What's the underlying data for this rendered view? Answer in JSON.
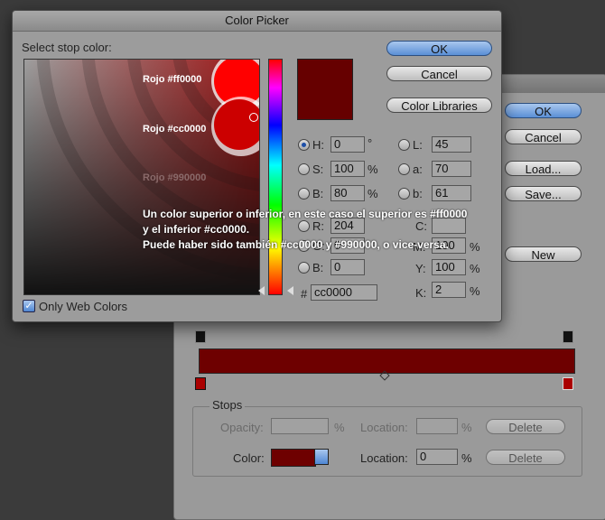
{
  "picker": {
    "title": "Color Picker",
    "select_label": "Select stop color:",
    "ok": "OK",
    "cancel": "Cancel",
    "libraries": "Color Libraries",
    "only_web": "Only Web Colors",
    "hex_label": "#",
    "hex_value": "cc0000",
    "swatch_color": "#660000",
    "fields": {
      "H": {
        "label": "H:",
        "value": "0",
        "unit": "°"
      },
      "S": {
        "label": "S:",
        "value": "100",
        "unit": "%"
      },
      "B": {
        "label": "B:",
        "value": "80",
        "unit": "%"
      },
      "R": {
        "label": "R:",
        "value": "204"
      },
      "G": {
        "label": "G:",
        "value": "0"
      },
      "Bl": {
        "label": "B:",
        "value": "0"
      },
      "L": {
        "label": "L:",
        "value": "45"
      },
      "a": {
        "label": "a:",
        "value": "70"
      },
      "b": {
        "label": "b:",
        "value": "61"
      },
      "C": {
        "label": "C:",
        "value": ""
      },
      "M": {
        "label": "M:",
        "value": "100",
        "unit": "%"
      },
      "Y": {
        "label": "Y:",
        "value": "100",
        "unit": "%"
      },
      "K": {
        "label": "K:",
        "value": "2",
        "unit": "%"
      }
    },
    "annotations": {
      "rojo1": "Rojo #ff0000",
      "rojo2": "Rojo #cc0000",
      "rojo3": "Rojo #990000",
      "line1": "Un color superior o inferior, en este caso el superior es #ff0000",
      "line2": "y el inferior #cc0000.",
      "line3": "Puede haber sido también #cc0000 y #990000, o vice-versa."
    }
  },
  "editor": {
    "ok": "OK",
    "cancel": "Cancel",
    "load": "Load...",
    "save": "Save...",
    "new": "New",
    "stops_label": "Stops",
    "opacity_label": "Opacity:",
    "location_label": "Location:",
    "delete_label": "Delete",
    "color_label": "Color:",
    "location_value": "0",
    "percent": "%",
    "gradient_color": "#6e0000"
  }
}
